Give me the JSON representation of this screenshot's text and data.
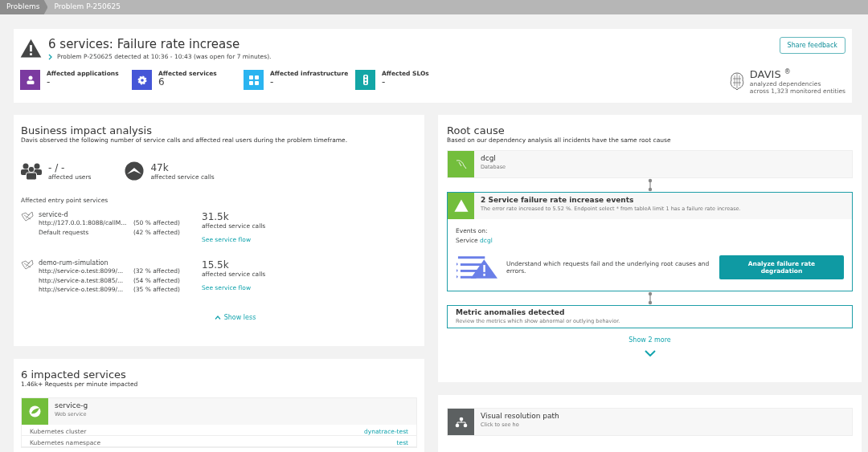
{
  "breadcrumbs": [
    {
      "label": "Problems",
      "selected": false
    },
    {
      "label": "Problem P-250625",
      "selected": true
    }
  ],
  "problem": {
    "title": "6 services: Failure rate increase",
    "detail": "Problem P-250625 detected at 10:36 - 10:43 (was open for 7 minutes).",
    "feedback_button": "Share feedback",
    "affected": [
      {
        "kind": "applications",
        "label": "Affected applications",
        "value": "-",
        "color": "#7b3aa0"
      },
      {
        "kind": "services",
        "label": "Affected services",
        "value": "6",
        "color": "#4556d7"
      },
      {
        "kind": "infrastructure",
        "label": "Affected infrastructure",
        "value": "-",
        "color": "#2ab4f0"
      },
      {
        "kind": "slo",
        "label": "Affected SLOs",
        "value": "-",
        "color": "#13a6a6"
      }
    ],
    "davis": {
      "name": "DAVIS",
      "mark": "®",
      "line_1": "analyzed dependencies",
      "line_2": "across 1,323 monitored entities"
    }
  },
  "business": {
    "title": "Business impact analysis",
    "subtitle": "Davis observed the following number of service calls and affected real users during the problem timeframe.",
    "stats": [
      {
        "kind": "users",
        "value": "- / -",
        "label": "affected users"
      },
      {
        "kind": "calls",
        "value": "47k",
        "label": "affected service calls"
      }
    ],
    "entry_title": "Affected entry point services",
    "entries": [
      {
        "name": "service-d",
        "requests": [
          {
            "url": "http://127.0.0.1:8088/callM...",
            "share": "(50 % affected)"
          },
          {
            "url": "Default requests",
            "share": "(42 % affected)"
          }
        ],
        "count": "31.5k",
        "count_label": "affected service calls",
        "link": "See service flow"
      },
      {
        "name": "demo-rum-simulation",
        "requests": [
          {
            "url": "http://service-o.test:8099/...",
            "share": "(32 % affected)"
          },
          {
            "url": "http://service-a.test:8085/...",
            "share": "(54 % affected)"
          },
          {
            "url": "http://service-o.test:8099/...",
            "share": "(35 % affected)"
          }
        ],
        "count": "15.5k",
        "count_label": "affected service calls",
        "link": "See service flow"
      }
    ],
    "toggle": "Show less"
  },
  "impacted": {
    "title": "6 impacted services",
    "subtitle": "1.46k+ Requests per minute impacted",
    "service": {
      "name": "service-g",
      "type": "Web service",
      "properties": [
        {
          "key": "Kubernetes cluster",
          "value": "dynatrace-test"
        },
        {
          "key": "Kubernetes namespace",
          "value": "test"
        }
      ]
    }
  },
  "root": {
    "title": "Root cause",
    "subtitle": "Based on our dependency analysis all incidents have the same root cause",
    "entity": {
      "name": "dcgl",
      "type": "Database"
    },
    "event": {
      "title": "2 Service failure rate increase events",
      "description": "The error rate increased to 5.52 %. Endpoint select * from tableA limit 1 has a failure rate increase.",
      "events_on": "Events on:",
      "service_prefix": "Service",
      "service_link": "dcgl",
      "hint": "Understand which requests fail and the underlying root causes and errors.",
      "button": "Analyze failure rate degradation"
    },
    "metric": {
      "title": "Metric anomalies detected",
      "description": "Review the metrics which show abnormal or outlying behavior."
    },
    "more": "Show 2 more"
  },
  "visual": {
    "title": "Visual resolution path",
    "subtitle": "Click to see ho"
  }
}
